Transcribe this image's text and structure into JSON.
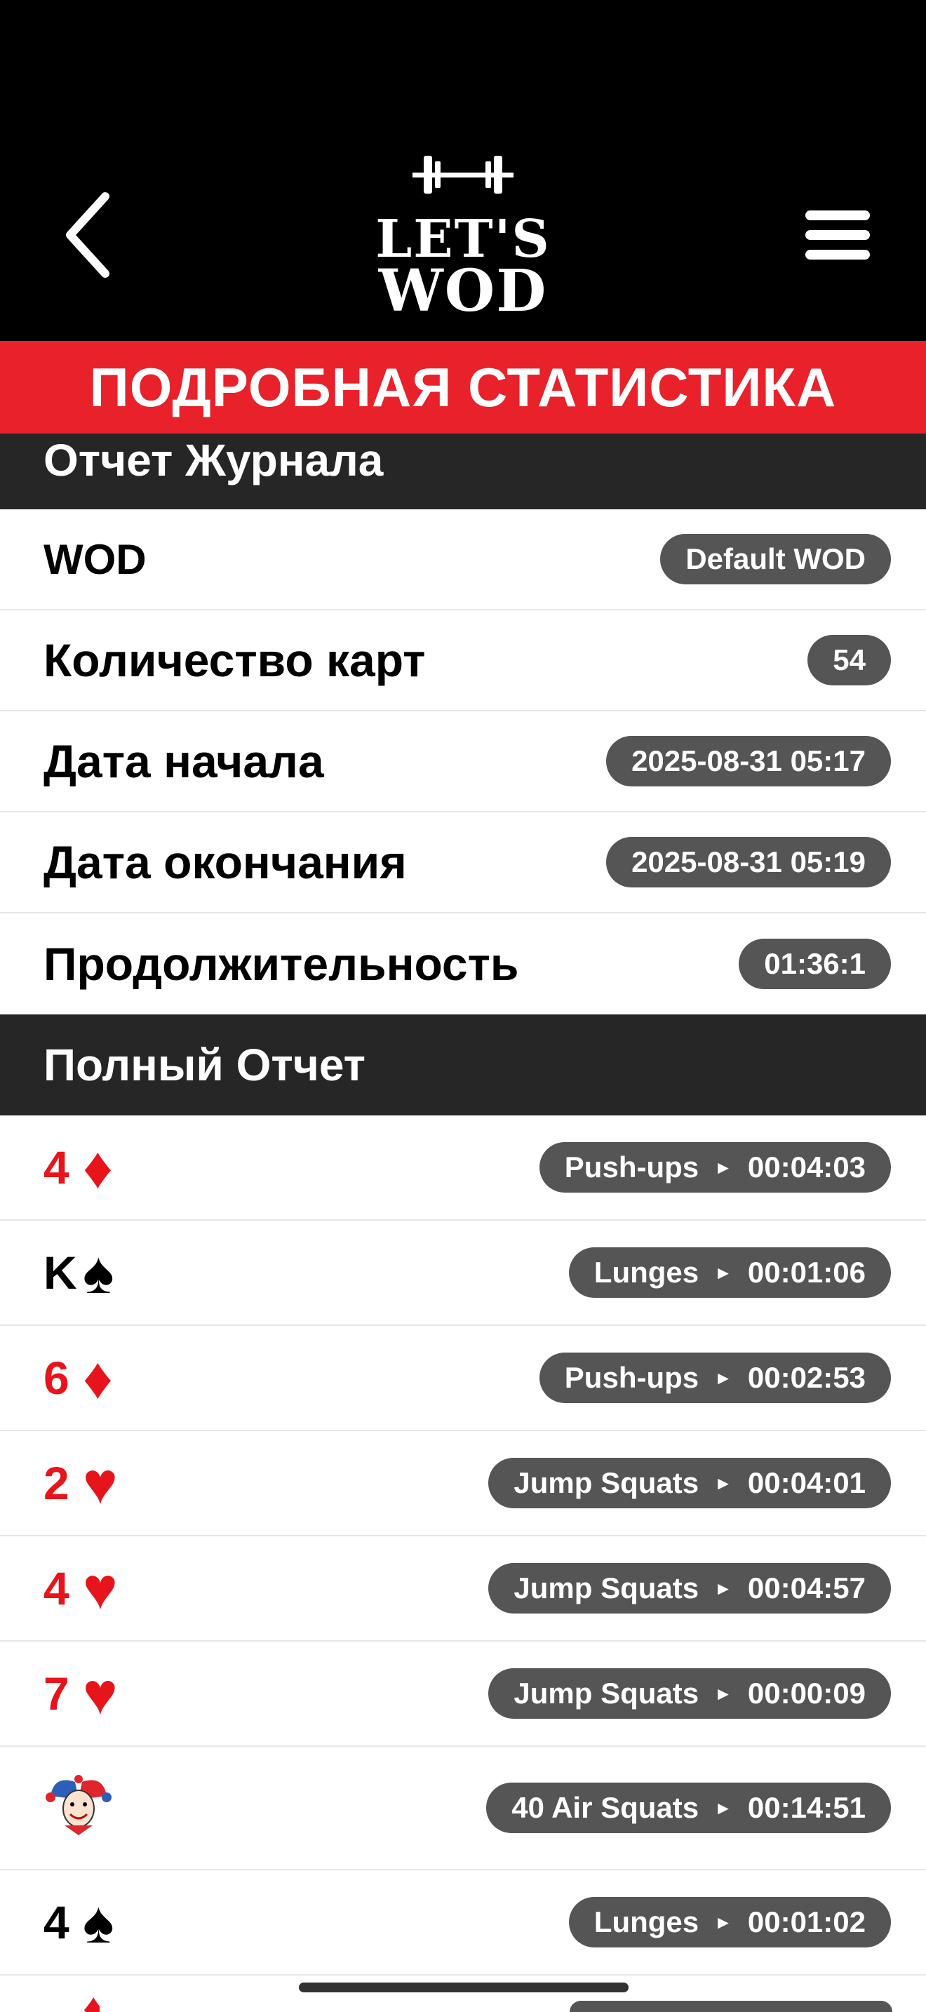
{
  "header": {
    "back_icon": "chevron-left-icon",
    "menu_icon": "hamburger-menu-icon",
    "logo": {
      "line1": "LET'S",
      "line2": "WOD"
    }
  },
  "banner": {
    "title": "ПОДРОБНАЯ СТАТИСТИКА"
  },
  "journal": {
    "title": "Отчет Журнала",
    "rows": [
      {
        "label": "WOD",
        "value": "Default WOD"
      },
      {
        "label": "Количество карт",
        "value": "54"
      },
      {
        "label": "Дата начала",
        "value": "2025-08-31 05:17"
      },
      {
        "label": "Дата окончания",
        "value": "2025-08-31 05:19"
      },
      {
        "label": "Продолжительность",
        "value": "01:36:1"
      }
    ]
  },
  "full_report": {
    "title": "Полный Отчет",
    "rows": [
      {
        "rank": "4",
        "suit": "♦",
        "color": "#e8141c",
        "exercise": "Push-ups",
        "arrow": "►",
        "time": "00:04:03"
      },
      {
        "rank": "K",
        "suit": "♠",
        "color": "#000000",
        "exercise": "Lunges",
        "arrow": "►",
        "time": "00:01:06"
      },
      {
        "rank": "6",
        "suit": "♦",
        "color": "#e8141c",
        "exercise": "Push-ups",
        "arrow": "►",
        "time": "00:02:53"
      },
      {
        "rank": "2",
        "suit": "♥",
        "color": "#e8141c",
        "exercise": "Jump Squats",
        "arrow": "►",
        "time": "00:04:01"
      },
      {
        "rank": "4",
        "suit": "♥",
        "color": "#e8141c",
        "exercise": "Jump Squats",
        "arrow": "►",
        "time": "00:04:57"
      },
      {
        "rank": "7",
        "suit": "♥",
        "color": "#e8141c",
        "exercise": "Jump Squats",
        "arrow": "►",
        "time": "00:00:09"
      },
      {
        "rank": "",
        "suit": "",
        "joker": true,
        "exercise": "40 Air Squats",
        "arrow": "►",
        "time": "00:14:51"
      },
      {
        "rank": "4",
        "suit": "♠",
        "color": "#000000",
        "exercise": "Lunges",
        "arrow": "►",
        "time": "00:01:02"
      }
    ]
  },
  "colors": {
    "accent_red": "#e8212b",
    "header_bg": "#000000",
    "section_bg": "#262626",
    "pill_bg": "#555555"
  }
}
